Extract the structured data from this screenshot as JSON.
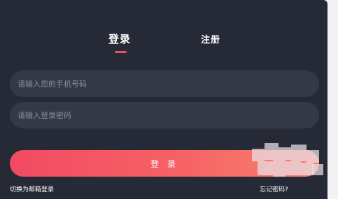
{
  "tabs": {
    "login": "登录",
    "register": "注册"
  },
  "form": {
    "phone_placeholder": "请输入您的手机号码",
    "password_placeholder": "请输入登录密码",
    "login_button": "登 录"
  },
  "links": {
    "switch_email": "切换为邮箱登录",
    "forgot_password": "忘记密码?"
  },
  "colors": {
    "panel": "#262a36",
    "field": "#353946",
    "accent": "#f0505f",
    "button_start": "#f24a62",
    "button_end": "#f8826b"
  }
}
